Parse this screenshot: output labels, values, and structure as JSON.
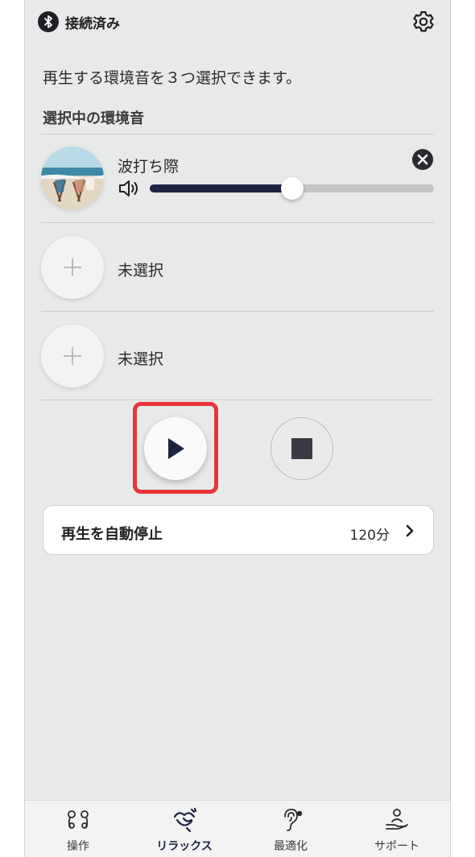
{
  "header": {
    "status_text": "接続済み",
    "status_icon": "bluetooth-icon",
    "settings_icon": "gear-icon"
  },
  "intro_text": "再生する環境音を３つ選択できます。",
  "section_title": "選択中の環境音",
  "slots": [
    {
      "label": "波打ち際",
      "state": "selected",
      "volume_fraction": 0.5
    },
    {
      "label": "未選択",
      "state": "empty"
    },
    {
      "label": "未選択",
      "state": "empty"
    }
  ],
  "playback": {
    "play_icon": "play-icon",
    "stop_icon": "stop-icon"
  },
  "auto_stop": {
    "label": "再生を自動停止",
    "value": "120分"
  },
  "bottom_nav": {
    "active_index": 1,
    "items": [
      {
        "label": "操作",
        "icon": "earbuds-icon"
      },
      {
        "label": "リラックス",
        "icon": "relax-bird-icon"
      },
      {
        "label": "最適化",
        "icon": "ear-icon"
      },
      {
        "label": "サポート",
        "icon": "support-hand-icon"
      }
    ]
  },
  "colors": {
    "accent": "#1d2340",
    "highlight": "#e8343a",
    "background": "#e8e9e9"
  }
}
